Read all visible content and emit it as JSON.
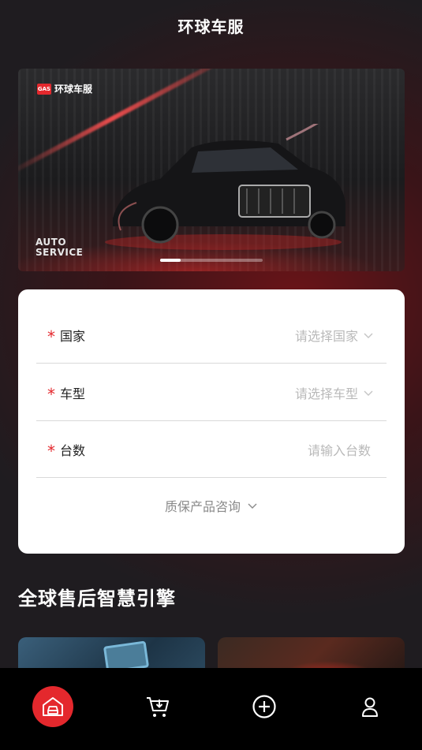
{
  "header": {
    "title": "环球车服"
  },
  "banner": {
    "brand_mark": "GAS",
    "brand_name": "环球车服",
    "tagline_line1": "AUTO",
    "tagline_line2": "SERVICE",
    "active_slide": 1
  },
  "form": {
    "country": {
      "label": "国家",
      "placeholder": "请选择国家"
    },
    "car_model": {
      "label": "车型",
      "placeholder": "请选择车型"
    },
    "quantity": {
      "label": "台数",
      "placeholder": "请输入台数"
    },
    "warranty_link": "质保产品咨询",
    "required_mark": "*"
  },
  "section": {
    "title": "全球售后智慧引擎"
  },
  "tabbar": {
    "items": [
      {
        "icon": "garage-car-icon",
        "active": true
      },
      {
        "icon": "cart-download-icon",
        "active": false
      },
      {
        "icon": "plus-circle-icon",
        "active": false
      },
      {
        "icon": "user-icon",
        "active": false
      }
    ],
    "accent": "#e4282d"
  }
}
